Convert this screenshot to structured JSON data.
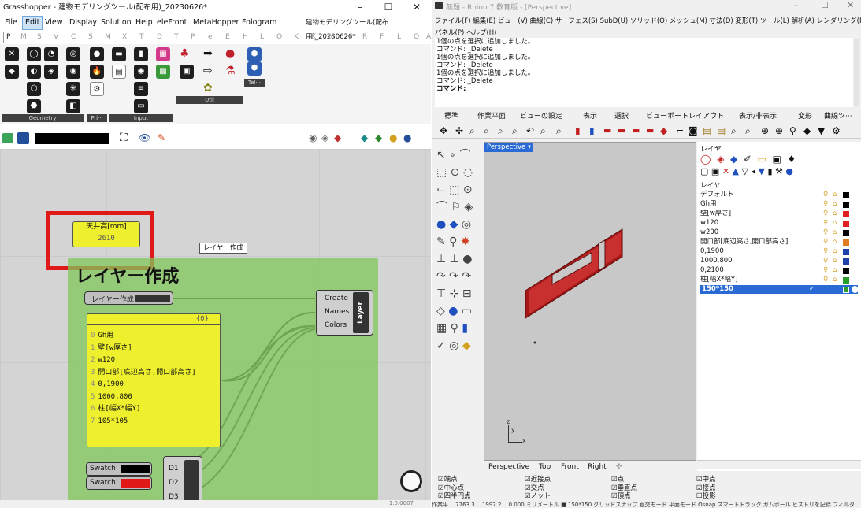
{
  "gh": {
    "title": "Grasshopper - 建物モデリングツール(配布用)_20230626*",
    "menu": [
      "File",
      "Edit",
      "View",
      "Display",
      "Solution",
      "Help",
      "eleFront",
      "MetaHopper",
      "Fologram"
    ],
    "doc_title": "建物モデリングツール(配布用)_20230626*",
    "tabs": [
      "P",
      "M",
      "S",
      "V",
      "C",
      "S",
      "M",
      "X",
      "T",
      "D",
      "T",
      "P",
      "e",
      "E",
      "H",
      "L",
      "O",
      "K",
      "K",
      "M",
      "H",
      "R",
      "F",
      "L",
      "O",
      "A"
    ],
    "ribbon_groups": [
      "Geometry",
      "Pri···",
      "Input",
      "Util"
    ],
    "tel_label": "Tel···",
    "status_version": "1.0.0007",
    "canvas": {
      "ceiling_panel_title": "天井高[mm]",
      "ceiling_panel_value": "2610",
      "group_tooltip": "レイヤー作成",
      "group_title": "レイヤー作成",
      "toggle_label": "レイヤー作成",
      "panel_header": "{0}",
      "panel_rows": [
        {
          "idx": "0",
          "text": "Gh用"
        },
        {
          "idx": "1",
          "text": "壁[w厚さ]"
        },
        {
          "idx": "2",
          "text": "w120"
        },
        {
          "idx": "3",
          "text": "開口部[底辺高さ,開口部高さ]"
        },
        {
          "idx": "4",
          "text": "0,1900"
        },
        {
          "idx": "5",
          "text": "1000,800"
        },
        {
          "idx": "6",
          "text": "柱[幅X*幅Y]"
        },
        {
          "idx": "7",
          "text": "105*105"
        }
      ],
      "layer_inputs": [
        "Create",
        "Names",
        "Colors"
      ],
      "layer_label": "Layer",
      "swatch_label": "Swatch",
      "d_outputs": [
        "D1",
        "D2",
        "D3"
      ]
    }
  },
  "rhino": {
    "title": "無題 - Rhino 7 教育版 - [Perspective]",
    "menu_line1": "ファイル(F) 編集(E) ビュー(V) 曲線(C) サーフェス(S) SubD(U) ソリッド(O) メッシュ(M) 寸法(D) 変形(T) ツール(L) 解析(A) レンダリング(R)",
    "menu_line2": "パネル(P) ヘルプ(H)",
    "command_history": [
      "1個の点を選択に追加しました。",
      "コマンド: _Delete",
      "1個の点を選択に追加しました。",
      "コマンド: _Delete",
      "1個の点を選択に追加しました。",
      "コマンド: _Delete",
      "コマンド:"
    ],
    "toolbar_tabs": [
      "標準",
      "作業平面",
      "ビューの設定",
      "表示",
      "選択",
      "ビューポートレイアウト",
      "表示/非表示",
      "変形",
      "曲線ツ···"
    ],
    "viewport_label": "Perspective",
    "axis_z": "z",
    "axis_y": "y",
    "axis_x": "x",
    "viewport_tabs": [
      "Perspective",
      "Top",
      "Front",
      "Right"
    ],
    "layers_title": "レイヤ",
    "layers_list_title": "レイヤ",
    "layers": [
      {
        "name": "デフォルト",
        "color": "#000000"
      },
      {
        "name": "Gh用",
        "color": "#000000"
      },
      {
        "name": "壁[w厚さ]",
        "color": "#e02020"
      },
      {
        "name": "w120",
        "color": "#e02020"
      },
      {
        "name": "w200",
        "color": "#000000"
      },
      {
        "name": "開口部[底辺高さ,開口部高さ]",
        "color": "#e07b20"
      },
      {
        "name": "0,1900",
        "color": "#1e3fa8"
      },
      {
        "name": "1000,800",
        "color": "#1e3fa8"
      },
      {
        "name": "0,2100",
        "color": "#000000"
      },
      {
        "name": "柱[幅X*幅Y]",
        "color": "#2a9d2a"
      },
      {
        "name": "150*150",
        "color": "#2a9d2a",
        "selected": true
      }
    ],
    "osnaps": [
      [
        "端点",
        "近接点",
        "点",
        "中点"
      ],
      [
        "中心点",
        "交点",
        "垂直点",
        "接点"
      ],
      [
        "四半円点",
        "ノット",
        "頂点",
        "投影"
      ]
    ],
    "status_bar": "作業平… 7763.3… 1997.2… 0.000  ミリメートル ■ 150*150    グリッドスナップ 直交モード 平面モード Osnap スマートトラック ガムボール ヒストリを記録 フィルタ"
  }
}
